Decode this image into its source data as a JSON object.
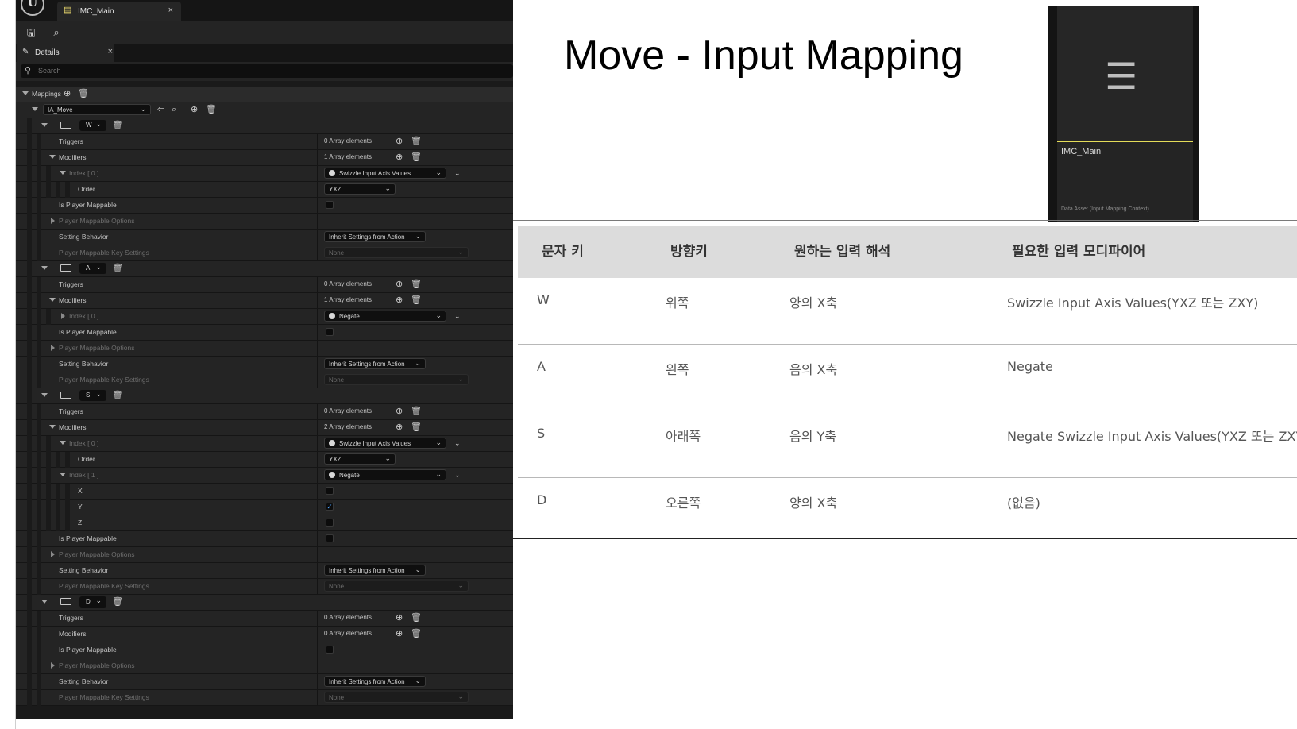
{
  "editor": {
    "asset_tab": {
      "label": "IMC_Main",
      "close": "×"
    },
    "panel_tab": {
      "label": "Details",
      "close": "×"
    },
    "search": {
      "placeholder": "Search"
    },
    "mappings_label": "Mappings",
    "action": {
      "value": "IA_Move"
    },
    "labels": {
      "triggers": "Triggers",
      "modifiers": "Modifiers",
      "index0": "Index [ 0 ]",
      "index1": "Index [ 1 ]",
      "order": "Order",
      "is_player_mappable": "Is Player Mappable",
      "player_mappable_options": "Player Mappable Options",
      "setting_behavior": "Setting Behavior",
      "player_mappable_key_settings": "Player Mappable Key Settings",
      "x": "X",
      "y": "Y",
      "z": "Z"
    },
    "values": {
      "zero_elements": "0 Array elements",
      "one_element": "1 Array elements",
      "two_elements": "2 Array elements",
      "swizzle": "Swizzle Input Axis Values",
      "negate": "Negate",
      "order_value": "YXZ",
      "inherit": "Inherit Settings from Action",
      "none": "None"
    },
    "keys": [
      "W",
      "A",
      "S",
      "D"
    ],
    "negate_axes": {
      "x": false,
      "y": true,
      "z": false
    }
  },
  "slide": {
    "title": "Move - Input Mapping",
    "asset": {
      "name": "IMC_Main",
      "type": "Data Asset (Input Mapping Context)"
    },
    "table": {
      "headers": [
        "문자 키",
        "방향키",
        "원하는 입력 해석",
        "필요한 입력 모디파이어"
      ],
      "rows": [
        [
          "W",
          "위쪽",
          "양의 X축",
          "Swizzle Input Axis Values(YXZ 또는 ZXY)"
        ],
        [
          "A",
          "왼쪽",
          "음의 X축",
          "Negate"
        ],
        [
          "S",
          "아래쪽",
          "음의 Y축",
          "Negate Swizzle Input Axis Values(YXZ 또는 ZXY)"
        ],
        [
          "D",
          "오른쪽",
          "양의 X축",
          "(없음)"
        ]
      ]
    }
  }
}
